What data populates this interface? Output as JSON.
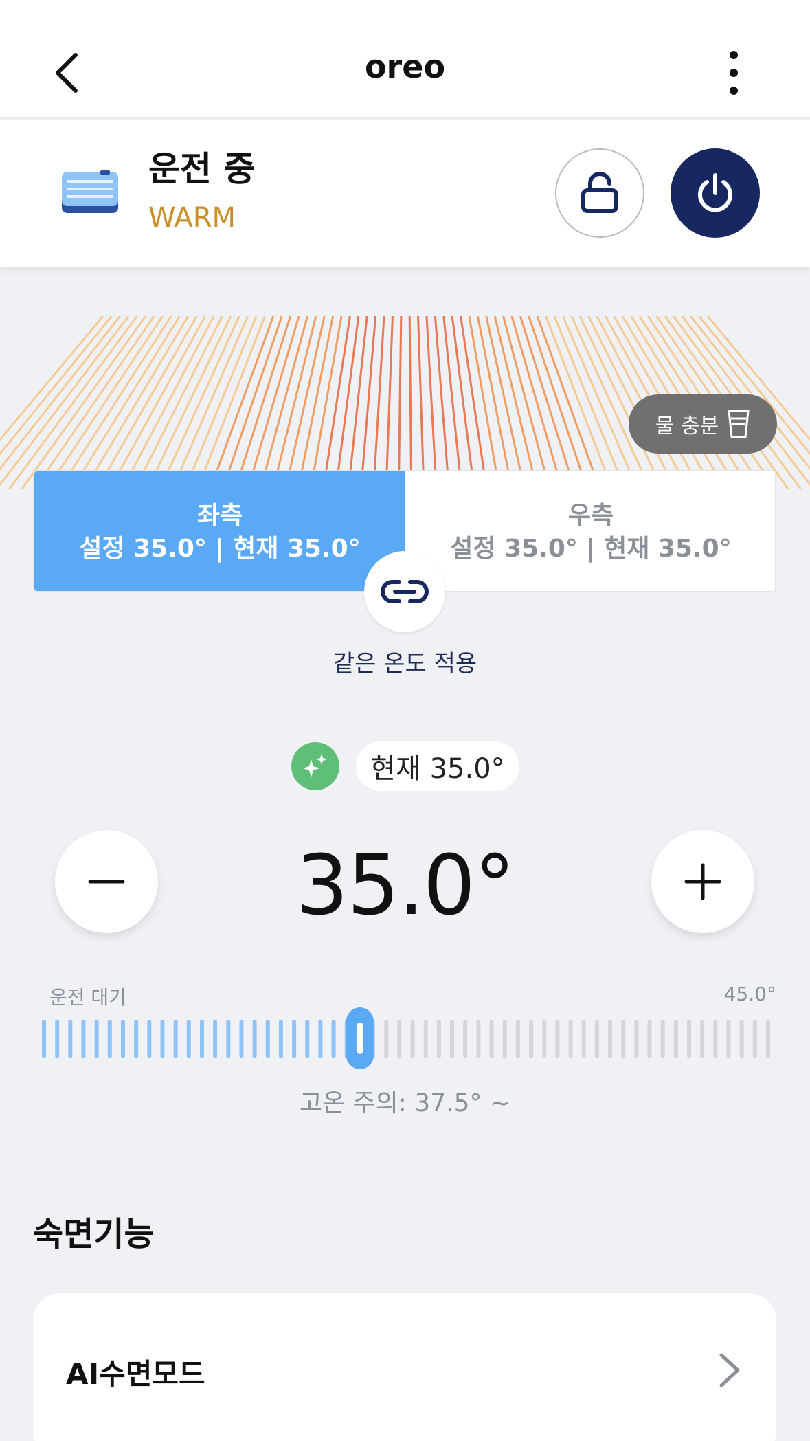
{
  "header": {
    "title": "oreo",
    "back_icon": "chevron-left-icon",
    "more_icon": "more-vertical-icon"
  },
  "status": {
    "label": "운전 중",
    "mode": "WARM",
    "mode_color": "#c98f2c",
    "device_icon": "mattress-pad-icon",
    "lock_icon": "unlock-icon",
    "power_icon": "power-icon",
    "power_color": "#16285f"
  },
  "water": {
    "label": "물 충분",
    "icon": "water-cup-icon",
    "badge_color": "#707070"
  },
  "zones": {
    "left": {
      "name": "좌측",
      "detail": "설정 35.0° | 현재 35.0°",
      "selected": true,
      "color": "#5aa9f5"
    },
    "right": {
      "name": "우측",
      "detail": "설정 35.0° | 현재 35.0°",
      "selected": false
    },
    "link_icon": "link-icon",
    "same_temp_label": "같은 온도 적용"
  },
  "temperature": {
    "ai_icon": "sparkle-icon",
    "current_label": "현재 35.0°",
    "setpoint": "35.0°",
    "minus_icon": "minus-icon",
    "plus_icon": "plus-icon"
  },
  "slider": {
    "min_label": "운전 대기",
    "max_label": "45.0°",
    "position_fraction": 0.438,
    "active_color": "#8fc3f5",
    "thumb_color": "#5aa9f5",
    "warning": "고온 주의: 37.5° ~"
  },
  "sleep": {
    "section_title": "숙면기능",
    "items": [
      {
        "label": "AI수면모드",
        "icon": "chevron-right-icon"
      }
    ]
  }
}
